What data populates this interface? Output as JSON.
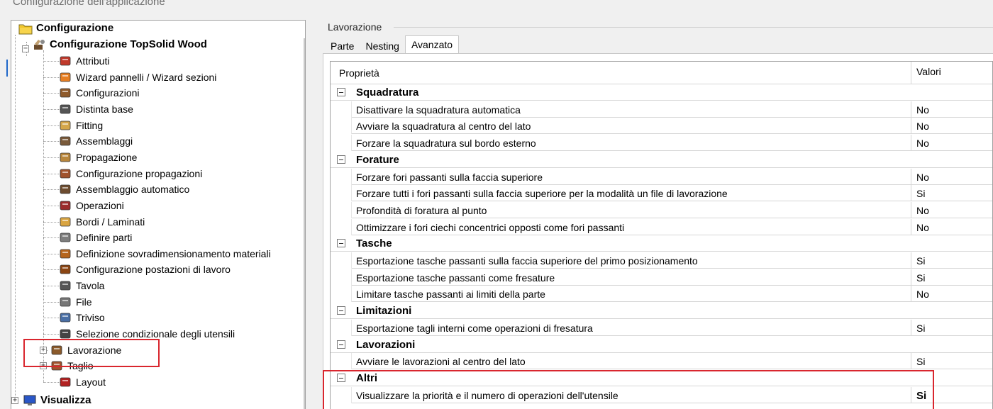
{
  "window": {
    "title": "Configurazione dell'applicazione"
  },
  "tree": {
    "root": {
      "label": "Configurazione",
      "icon": "folder-icon"
    },
    "topsolid": {
      "label": "Configurazione TopSolid Wood",
      "icon": "tools-icon",
      "expander": "−"
    },
    "items": [
      {
        "label": "Attributi",
        "icon": "color-wheel-icon"
      },
      {
        "label": "Wizard pannelli / Wizard sezioni",
        "icon": "panel-wizard-icon"
      },
      {
        "label": "Configurazioni",
        "icon": "configurations-icon"
      },
      {
        "label": "Distinta base",
        "icon": "bill-of-materials-icon"
      },
      {
        "label": "Fitting",
        "icon": "fitting-icon"
      },
      {
        "label": "Assemblaggi",
        "icon": "assembly-icon"
      },
      {
        "label": "Propagazione",
        "icon": "propagation-icon"
      },
      {
        "label": "Configurazione propagazioni",
        "icon": "propagation-config-icon"
      },
      {
        "label": "Assemblaggio automatico",
        "icon": "auto-assembly-icon"
      },
      {
        "label": "Operazioni",
        "icon": "operations-icon"
      },
      {
        "label": "Bordi / Laminati",
        "icon": "edges-icon"
      },
      {
        "label": "Definire parti",
        "icon": "define-parts-icon"
      },
      {
        "label": "Definizione sovradimensionamento materiali",
        "icon": "material-oversize-icon"
      },
      {
        "label": "Configurazione postazioni di lavoro",
        "icon": "workstation-icon"
      },
      {
        "label": "Tavola",
        "icon": "drawing-board-icon"
      },
      {
        "label": "File",
        "icon": "file-icon"
      },
      {
        "label": "Triviso",
        "icon": "triviso-icon"
      },
      {
        "label": "Selezione condizionale degli utensili",
        "icon": "tool-selection-icon"
      },
      {
        "label": "Lavorazione",
        "icon": "machining-icon",
        "expander": "+"
      },
      {
        "label": "Taglio",
        "icon": "cutting-icon",
        "expander": "+"
      },
      {
        "label": "Layout",
        "icon": "layout-icon"
      }
    ],
    "visualizza": {
      "label": "Visualizza",
      "icon": "monitor-icon",
      "expander": "+"
    }
  },
  "panel": {
    "group_title": "Lavorazione",
    "tabs": [
      {
        "label": "Parte"
      },
      {
        "label": "Nesting"
      },
      {
        "label": "Avanzato"
      }
    ],
    "active_tab": "Avanzato"
  },
  "grid": {
    "columns": {
      "property": "Proprietà",
      "value": "Valori"
    },
    "categories": [
      {
        "name": "Squadratura",
        "rows": [
          {
            "label": "Disattivare la squadratura automatica",
            "value": "No"
          },
          {
            "label": "Avviare la squadratura al centro del lato",
            "value": "No"
          },
          {
            "label": "Forzare la squadratura sul bordo esterno",
            "value": "No"
          }
        ]
      },
      {
        "name": "Forature",
        "rows": [
          {
            "label": "Forzare fori passanti sulla faccia superiore",
            "value": "No"
          },
          {
            "label": "Forzare tutti i fori passanti sulla faccia superiore per la modalità un file di lavorazione",
            "value": "Si"
          },
          {
            "label": "Profondità di foratura al punto",
            "value": "No"
          },
          {
            "label": "Ottimizzare i fori ciechi concentrici opposti come fori passanti",
            "value": "No"
          }
        ]
      },
      {
        "name": "Tasche",
        "rows": [
          {
            "label": "Esportazione tasche passanti sulla faccia superiore del primo posizionamento",
            "value": "Si"
          },
          {
            "label": "Esportazione tasche passanti come fresature",
            "value": "Si"
          },
          {
            "label": "Limitare tasche passanti ai limiti della parte",
            "value": "No"
          }
        ]
      },
      {
        "name": "Limitazioni",
        "rows": [
          {
            "label": "Esportazione tagli interni come operazioni di fresatura",
            "value": "Si"
          }
        ]
      },
      {
        "name": "Lavorazioni",
        "rows": [
          {
            "label": "Avviare le lavorazioni al centro del lato",
            "value": "Si"
          }
        ]
      },
      {
        "name": "Altri",
        "rows": [
          {
            "label": "Visualizzare la priorità e il numero di operazioni dell'utensile",
            "value": "Si"
          }
        ]
      }
    ]
  },
  "colors": {
    "highlight": "#d9262e",
    "grid_line": "#d6d6d6",
    "accent": "#1f67c9"
  }
}
